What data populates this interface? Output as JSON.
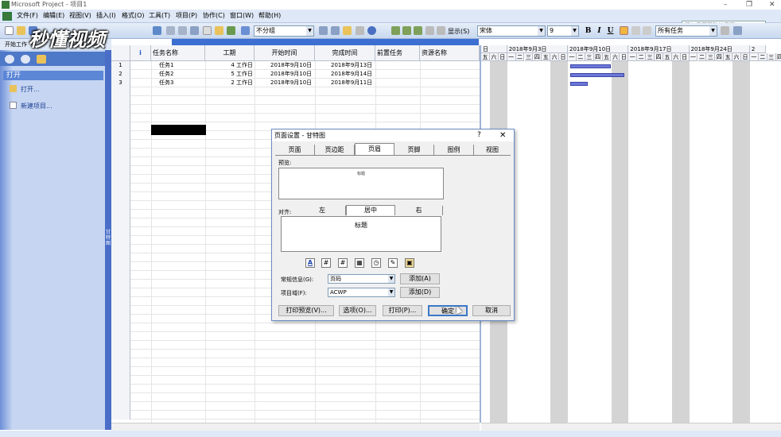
{
  "window": {
    "title": "Microsoft Project - 项目1",
    "controls": [
      "–",
      "❐",
      "✕"
    ]
  },
  "menu": {
    "items": [
      "文件(F)",
      "编辑(E)",
      "视图(V)",
      "插入(I)",
      "格式(O)",
      "工具(T)",
      "项目(P)",
      "协作(C)",
      "窗口(W)",
      "帮助(H)"
    ],
    "help_placeholder": "键入需要帮助的问题"
  },
  "toolbar": {
    "group_select": "不分组",
    "show_label": "显示(S)",
    "font_name": "宋体",
    "font_size": "9",
    "bold": "B",
    "italic": "I",
    "underline": "U",
    "filter_select": "所有任务",
    "start_work_label": "开始工作"
  },
  "watermark": "秒懂视频",
  "side_panel": {
    "header": "打开",
    "links": [
      "打开...",
      "新建项目..."
    ],
    "separator_label": "甘特图"
  },
  "table": {
    "info_icon": "i",
    "headers": [
      "任务名称",
      "工期",
      "开始时间",
      "完成时间",
      "前置任务",
      "资源名称"
    ],
    "rows": [
      {
        "id": "1",
        "name": "任务1",
        "duration": "4 工作日",
        "start": "2018年9月10日",
        "finish": "2018年9月13日"
      },
      {
        "id": "2",
        "name": "任务2",
        "duration": "5 工作日",
        "start": "2018年9月10日",
        "finish": "2018年9月14日"
      },
      {
        "id": "3",
        "name": "任务3",
        "duration": "2 工作日",
        "start": "2018年9月10日",
        "finish": "2018年9月11日"
      }
    ]
  },
  "gantt": {
    "weeks": [
      "日",
      "2018年9月3日",
      "2018年9月10日",
      "2018年9月17日",
      "2018年9月24日",
      "2"
    ],
    "days": [
      "五",
      "六",
      "日",
      "一",
      "二",
      "三",
      "四",
      "五",
      "六",
      "日",
      "一",
      "二",
      "三",
      "四",
      "五",
      "六",
      "日",
      "一",
      "二",
      "三",
      "四",
      "五",
      "六",
      "日",
      "一",
      "二",
      "三",
      "四",
      "五",
      "六",
      "日",
      "一",
      "二",
      "三",
      "四",
      "五",
      "六",
      "一"
    ],
    "tasks": [
      {
        "start": "2018-09-10",
        "days": 4
      },
      {
        "start": "2018-09-10",
        "days": 5
      },
      {
        "start": "2018-09-10",
        "days": 2
      }
    ]
  },
  "dialog": {
    "title": "页面设置 - 甘特图",
    "help": "?",
    "close": "✕",
    "tabs": [
      "页面",
      "页边距",
      "页眉",
      "页脚",
      "图例",
      "视图"
    ],
    "active_tab": "页眉",
    "preview_label": "预览:",
    "preview_text": "标题",
    "align_label": "对齐:",
    "align_tabs": [
      "左",
      "居中",
      "右"
    ],
    "active_align": "居中",
    "edit_text": "标题",
    "format_icons": [
      "A",
      "#",
      "#",
      "▦",
      "◷",
      "✎",
      "▣"
    ],
    "general_label": "常规信息(G):",
    "general_value": "页码",
    "add_label_1": "添加(A)",
    "project_field_label": "项目域(F):",
    "project_field_value": "ACWP",
    "add_label_2": "添加(D)",
    "print_preview": "打印预览(V)...",
    "options": "选项(O)...",
    "print": "打印(P)...",
    "ok": "确定",
    "cancel": "取消"
  }
}
